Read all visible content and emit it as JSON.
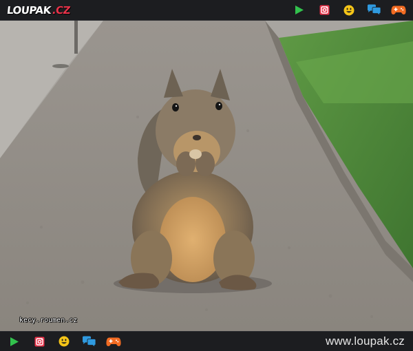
{
  "header": {
    "logo_main": "LOUPAK",
    "logo_tld": ".CZ",
    "icons": [
      "play-icon",
      "instagram-icon",
      "smiley-icon",
      "chat-icon",
      "gamepad-icon"
    ]
  },
  "photo": {
    "subject": "squirrel",
    "watermark": "kecy.roumen.cz"
  },
  "footer": {
    "site_url": "www.loupak.cz",
    "icons": [
      "play-icon",
      "instagram-icon",
      "smiley-icon",
      "chat-icon",
      "gamepad-icon"
    ]
  },
  "colors": {
    "bar_bg": "#1c1d20",
    "play": "#32c24d",
    "instagram": "#e8334a",
    "smiley": "#f5c518",
    "chat": "#2f9ae0",
    "gamepad": "#f26b22"
  }
}
